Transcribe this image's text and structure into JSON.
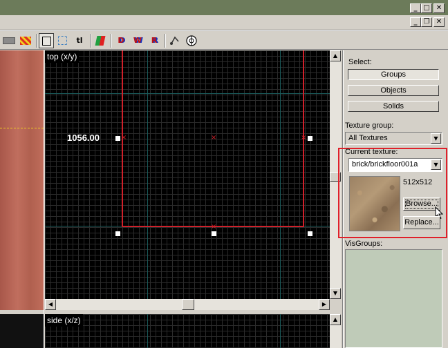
{
  "window": {
    "minimize_glyph": "_",
    "maximize_glyph": "□",
    "close_glyph": "✕",
    "restore_glyph": "❐"
  },
  "toolbar": {
    "text_tool_label": "tl",
    "tool_d_label": "D",
    "tool_w_label": "W",
    "tool_r_label": "R"
  },
  "viewport_top": {
    "label": "top (x/y)",
    "coordinate_readout": "1056.00"
  },
  "viewport_side": {
    "label": "side (x/z)"
  },
  "panel": {
    "select_label": "Select:",
    "groups_button": "Groups",
    "objects_button": "Objects",
    "solids_button": "Solids",
    "texture_group_label": "Texture group:",
    "texture_group_value": "All Textures",
    "current_texture_label": "Current texture:",
    "current_texture_value": "brick/brickfloor001a",
    "texture_size": "512x512",
    "browse_button": "Browse...",
    "replace_button": "Replace...",
    "visgroups_label": "VisGroups:"
  },
  "colors": {
    "highlight_border": "#e0202a",
    "brush_outline": "#d0202a",
    "grid_bg": "#000000"
  }
}
